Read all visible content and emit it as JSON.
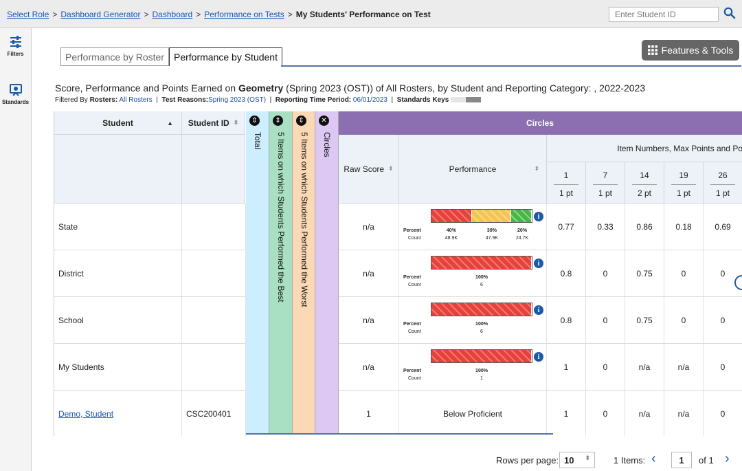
{
  "breadcrumb": {
    "items": [
      "Select Role",
      "Dashboard Generator",
      "Dashboard",
      "Performance on Tests"
    ],
    "current": "My Students' Performance on Test",
    "separator": ">"
  },
  "search": {
    "placeholder": "Enter Student ID"
  },
  "rail": {
    "filters_label": "Filters",
    "standards_label": "Standards"
  },
  "tabs": {
    "roster": "Performance by Roster",
    "student": "Performance by Student"
  },
  "features_label": "Features & Tools",
  "report": {
    "title_prefix": "Score, Performance and Points Earned on ",
    "title_subject": "Geometry",
    "title_suffix": " (Spring 2023 (OST)) of All Rosters, by Student and Reporting Category: , 2022-2023",
    "filters": {
      "prefix": "Filtered By",
      "rosters_label": "Rosters:",
      "rosters_value": "All Rosters",
      "reasons_label": "Test Reasons:",
      "reasons_value": "Spring 2023 (OST)",
      "period_label": "Reporting Time Period:",
      "period_value": "06/01/2023",
      "keys_label": "Standards Keys"
    }
  },
  "table": {
    "headers": {
      "student": "Student",
      "student_id": "Student ID",
      "total": "Total",
      "best": "5 Items on which Students Performed the Best",
      "worst": "5 Items on which Students Performed the Worst",
      "circles_col": "Circles",
      "circles_group": "Circles",
      "raw_score": "Raw Score",
      "performance": "Performance",
      "item_group": "Item Numbers, Max Points and Po"
    },
    "items": [
      {
        "num": "1",
        "pts": "1 pt"
      },
      {
        "num": "7",
        "pts": "1 pt"
      },
      {
        "num": "14",
        "pts": "2 pt"
      },
      {
        "num": "19",
        "pts": "1 pt"
      },
      {
        "num": "26",
        "pts": "1 pt"
      }
    ],
    "perf_labels": {
      "percent": "Percent",
      "count": "Count"
    },
    "rows": [
      {
        "name": "State",
        "id": "",
        "raw": "n/a",
        "perf": {
          "red": 40,
          "yellow": 39,
          "green": 20,
          "pct": [
            "40%",
            "39%",
            "20%"
          ],
          "cnt": [
            "48.9K",
            "47.9K",
            "24.7K"
          ]
        },
        "scores": [
          "0.77",
          "0.33",
          "0.86",
          "0.18",
          "0.69"
        ]
      },
      {
        "name": "District",
        "id": "",
        "raw": "n/a",
        "perf": {
          "red": 100,
          "pct": [
            "100%"
          ],
          "cnt": [
            "6"
          ]
        },
        "scores": [
          "0.8",
          "0",
          "0.75",
          "0",
          "0"
        ]
      },
      {
        "name": "School",
        "id": "",
        "raw": "n/a",
        "perf": {
          "red": 100,
          "pct": [
            "100%"
          ],
          "cnt": [
            "6"
          ]
        },
        "scores": [
          "0.8",
          "0",
          "0.75",
          "0",
          "0"
        ]
      },
      {
        "name": "My Students",
        "id": "",
        "raw": "n/a",
        "perf": {
          "red": 100,
          "pct": [
            "100%"
          ],
          "cnt": [
            "1"
          ]
        },
        "scores": [
          "1",
          "0",
          "n/a",
          "n/a",
          "0"
        ]
      },
      {
        "name": "Demo, Student",
        "id": "CSC200401",
        "raw": "1",
        "link": true,
        "perf_text": "Below Proficient",
        "scores": [
          "1",
          "0",
          "n/a",
          "n/a",
          "0"
        ]
      }
    ]
  },
  "pagination": {
    "rows_label": "Rows per page:",
    "rows_value": "10",
    "items_label": "1 Items:",
    "page": "1",
    "of_label": "of 1"
  },
  "colors": {
    "circles_header": "#8b6fb0",
    "total_col": "#cdeeff",
    "best_col": "#a9dfc2",
    "worst_col": "#fbd9b5",
    "circles_col": "#ddc8f3"
  }
}
